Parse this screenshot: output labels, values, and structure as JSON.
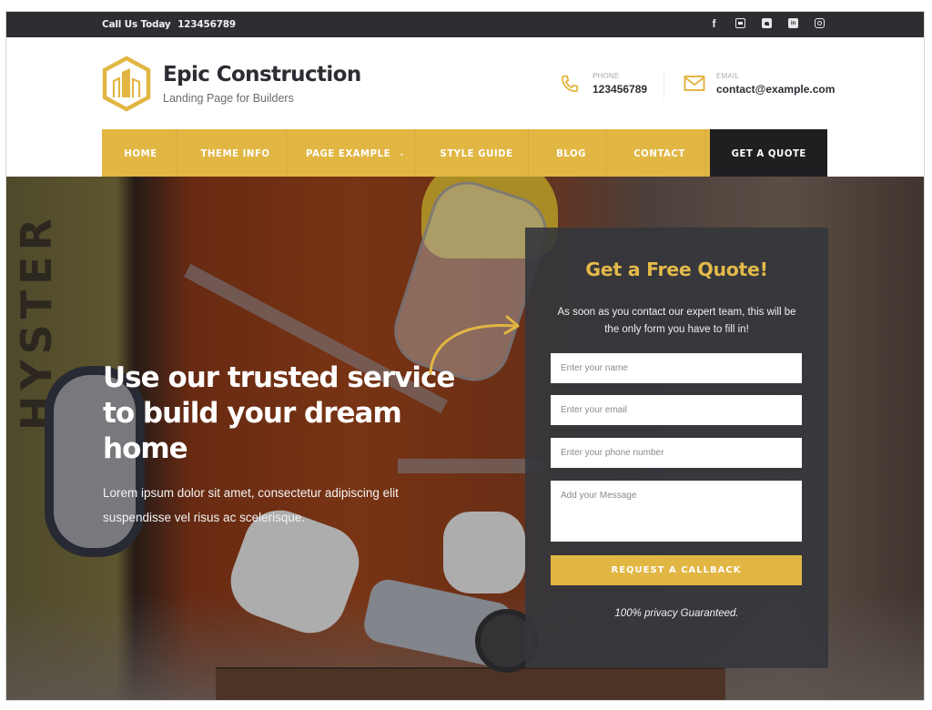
{
  "topbar": {
    "call_label": "Call Us Today",
    "call_number": "123456789",
    "social": [
      "facebook-icon",
      "youtube-icon",
      "twitter-icon",
      "linkedin-icon",
      "instagram-icon"
    ]
  },
  "header": {
    "brand_title": "Epic Construction",
    "brand_subtitle": "Landing Page for Builders",
    "phone_label": "PHONE",
    "phone_value": "123456789",
    "email_label": "EMAIL",
    "email_value": "contact@example.com"
  },
  "nav": {
    "items": [
      {
        "label": "HOME"
      },
      {
        "label": "THEME INFO"
      },
      {
        "label": "PAGE EXAMPLE",
        "has_dropdown": true
      },
      {
        "label": "STYLE GUIDE"
      },
      {
        "label": "BLOG"
      },
      {
        "label": "CONTACT"
      }
    ],
    "cta_label": "GET A QUOTE"
  },
  "hero": {
    "title": "Use our trusted service to build your dream home",
    "text": "Lorem ipsum dolor sit amet, consectetur adipiscing elit suspendisse vel risus ac scelerisque.",
    "background_text": "HYSTER"
  },
  "quote_form": {
    "title": "Get a Free Quote!",
    "subtitle": "As soon as you contact our expert team, this will be the only form you have to fill in!",
    "name_placeholder": "Enter your name",
    "email_placeholder": "Enter your email",
    "phone_placeholder": "Enter your phone number",
    "message_placeholder": "Add your Message",
    "submit_label": "REQUEST A CALLBACK",
    "privacy_note": "100% privacy Guaranteed."
  },
  "colors": {
    "accent": "#e1b643",
    "dark": "#2d2e32",
    "cta_dark": "#1f1f22"
  }
}
